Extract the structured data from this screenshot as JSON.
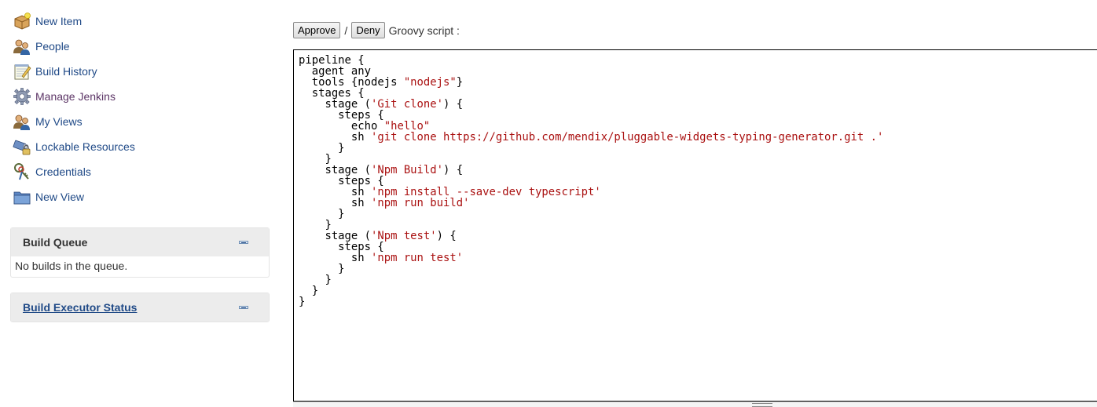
{
  "sidebar": {
    "tasks": [
      {
        "label": "New Item",
        "icon": "new-package-icon"
      },
      {
        "label": "People",
        "icon": "user-group-icon"
      },
      {
        "label": "Build History",
        "icon": "notepad-icon"
      },
      {
        "label": "Manage Jenkins",
        "icon": "gear-icon"
      },
      {
        "label": "My Views",
        "icon": "user-group-icon"
      },
      {
        "label": "Lockable Resources",
        "icon": "usb-lock-icon"
      },
      {
        "label": "Credentials",
        "icon": "keys-icon"
      },
      {
        "label": "New View",
        "icon": "folder-icon"
      }
    ],
    "build_queue": {
      "title": "Build Queue",
      "empty_message": "No builds in the queue."
    },
    "executor_status": {
      "title": "Build Executor Status"
    }
  },
  "script_approval": {
    "approve_label": "Approve",
    "separator": "/",
    "deny_label": "Deny",
    "script_label": "Groovy script :",
    "script_lines": [
      [
        {
          "t": "pipeline {"
        }
      ],
      [
        {
          "t": "  agent any"
        }
      ],
      [
        {
          "t": "  tools {nodejs "
        },
        {
          "t": "\"nodejs\"",
          "s": 1
        },
        {
          "t": "}"
        }
      ],
      [
        {
          "t": "  stages {"
        }
      ],
      [
        {
          "t": "    stage ("
        },
        {
          "t": "'Git clone'",
          "s": 1
        },
        {
          "t": ") {"
        }
      ],
      [
        {
          "t": "      steps {"
        }
      ],
      [
        {
          "t": "        echo "
        },
        {
          "t": "\"hello\"",
          "s": 1
        }
      ],
      [
        {
          "t": "        sh "
        },
        {
          "t": "'git clone https://github.com/mendix/pluggable-widgets-typing-generator.git .'",
          "s": 1
        }
      ],
      [
        {
          "t": "      }"
        }
      ],
      [
        {
          "t": "    }"
        }
      ],
      [
        {
          "t": "    stage ("
        },
        {
          "t": "'Npm Build'",
          "s": 1
        },
        {
          "t": ") {"
        }
      ],
      [
        {
          "t": "      steps {"
        }
      ],
      [
        {
          "t": "        sh "
        },
        {
          "t": "'npm install --save-dev typescript'",
          "s": 1
        }
      ],
      [
        {
          "t": "        sh "
        },
        {
          "t": "'npm run build'",
          "s": 1
        }
      ],
      [
        {
          "t": "      }"
        }
      ],
      [
        {
          "t": "    }"
        }
      ],
      [
        {
          "t": "    stage ("
        },
        {
          "t": "'Npm test'",
          "s": 1
        },
        {
          "t": ") {"
        }
      ],
      [
        {
          "t": "      steps {"
        }
      ],
      [
        {
          "t": "        sh "
        },
        {
          "t": "'npm run test'",
          "s": 1
        }
      ],
      [
        {
          "t": "      }"
        }
      ],
      [
        {
          "t": "    }"
        }
      ],
      [
        {
          "t": "  }"
        }
      ],
      [
        {
          "t": "}"
        }
      ]
    ]
  },
  "colors": {
    "link": "#204a87",
    "visited_link": "#5c3566",
    "string": "#aa1111"
  }
}
